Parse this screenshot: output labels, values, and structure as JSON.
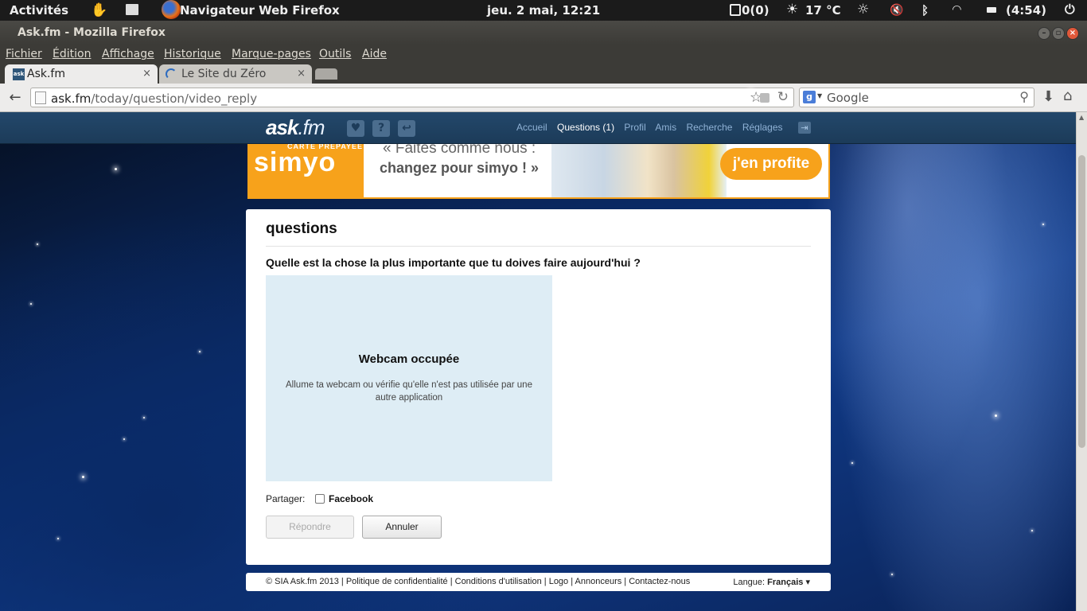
{
  "topbar": {
    "activities": "Activités",
    "app_name": "Navigateur Web Firefox",
    "datetime": "jeu.  2 mai, 12:21",
    "mail": "0(0)",
    "weather": "17 °C",
    "battery": "(4:54)"
  },
  "window": {
    "title": "Ask.fm - Mozilla Firefox"
  },
  "menubar": [
    "Fichier",
    "Édition",
    "Affichage",
    "Historique",
    "Marque-pages",
    "Outils",
    "Aide"
  ],
  "tabs": [
    {
      "label": "Ask.fm",
      "close": "×"
    },
    {
      "label": "Le Site du Zéro",
      "close": "×"
    }
  ],
  "navbar": {
    "url_host": "ask.fm",
    "url_path": "/today/question/video_reply",
    "search_placeholder": "Google",
    "search_engine": "g"
  },
  "askfm": {
    "logo_main": "ask",
    "logo_fm": ".fm",
    "nav": [
      "Accueil",
      "Questions (1)",
      "Profil",
      "Amis",
      "Recherche",
      "Réglages"
    ],
    "active_nav": "Questions (1)",
    "icons": [
      "heart-icon",
      "question-icon",
      "reply-icon",
      "logout-icon"
    ]
  },
  "ad": {
    "carte": "CARTE PRÉPAYÉE",
    "brand": "simyo",
    "line1": "« Faites comme nous :",
    "line2": "changez pour simyo ! »",
    "cta": "j'en profite",
    "brand_color": "#f7a21b"
  },
  "card": {
    "title": "questions",
    "question": "Quelle est la chose la plus importante que tu doives faire aujourd'hui ?",
    "webcam_title": "Webcam occupée",
    "webcam_desc": "Allume ta webcam ou vérifie qu'elle n'est pas utilisée par une autre application",
    "share_label": "Partager:",
    "facebook_label": "Facebook",
    "reply_button": "Répondre",
    "cancel_button": "Annuler"
  },
  "footer": {
    "links": "© SIA Ask.fm 2013 | Politique de confidentialité | Conditions d'utilisation | Logo | Annonceurs | Contactez-nous",
    "lang_label": "Langue:",
    "lang_value": "Français",
    "lang_caret": "▾"
  }
}
